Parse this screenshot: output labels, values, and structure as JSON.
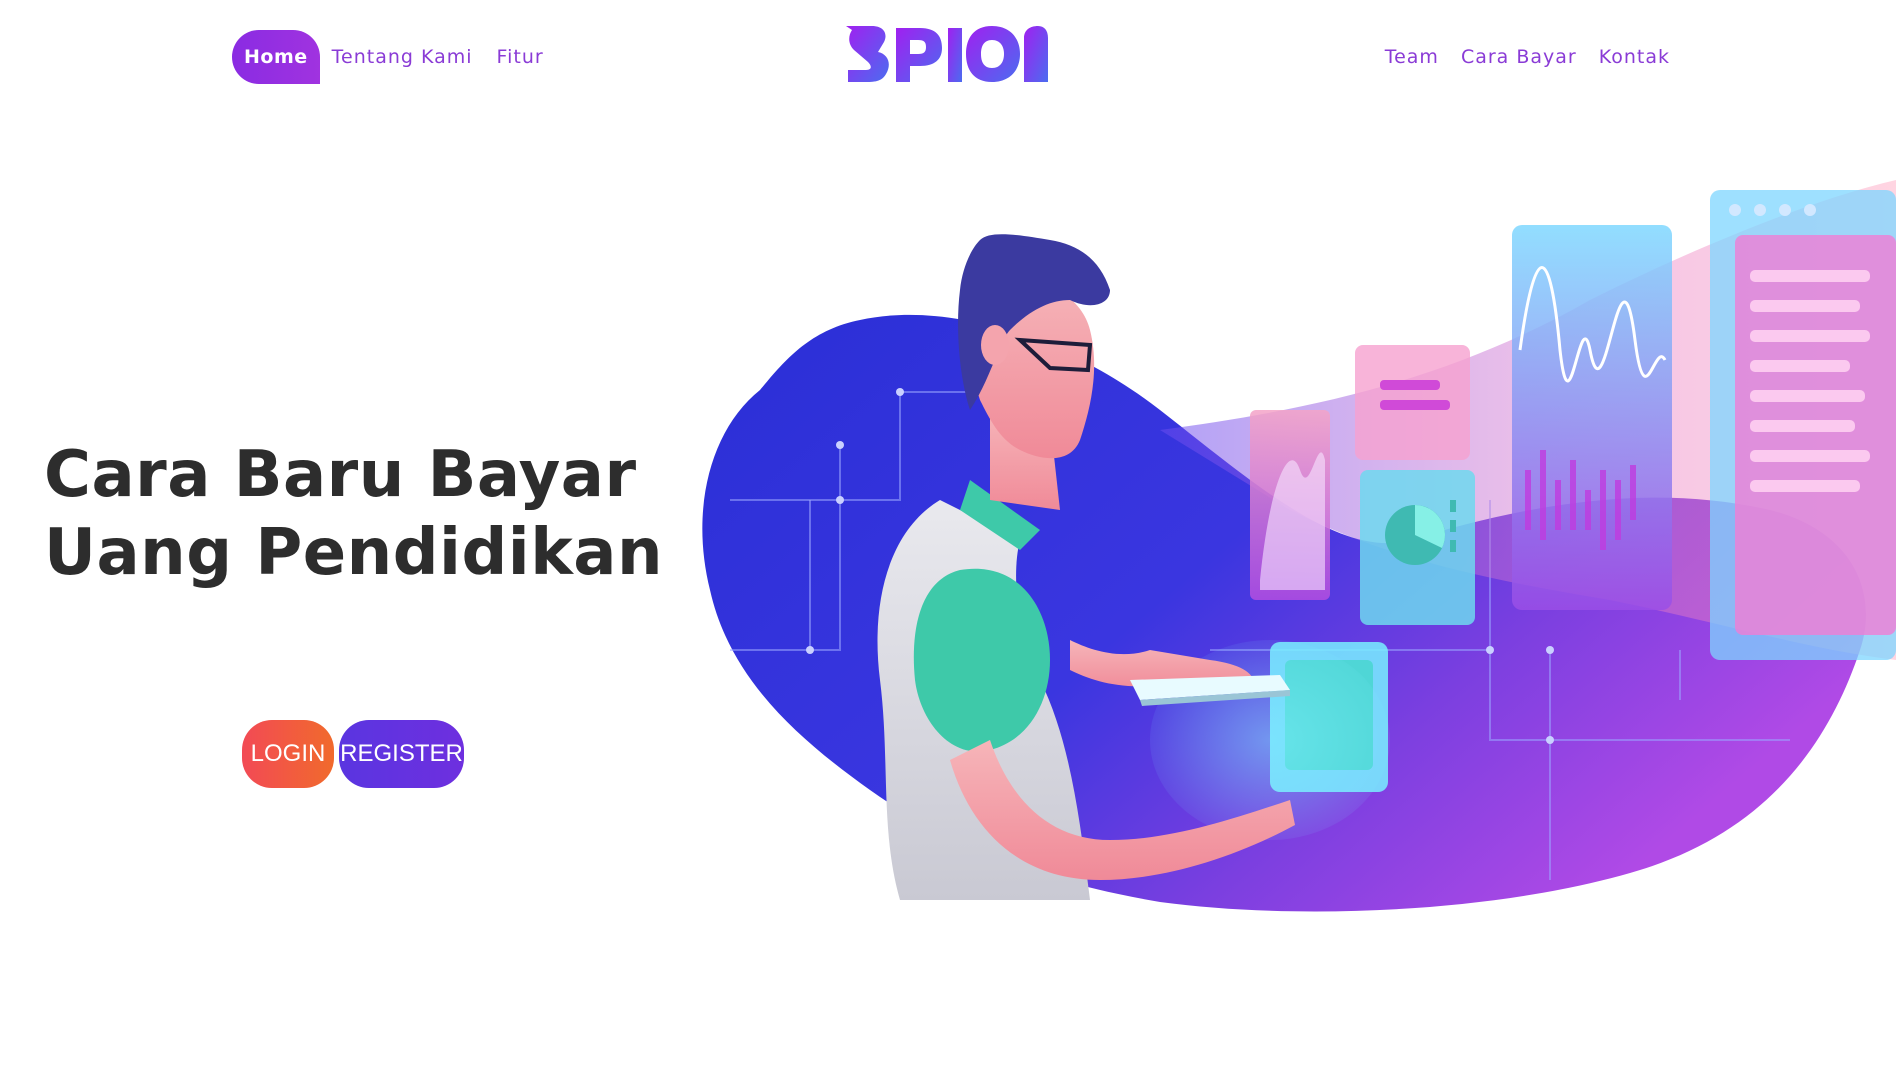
{
  "nav": {
    "left": [
      {
        "label": "Home",
        "active": true
      },
      {
        "label": "Tentang Kami"
      },
      {
        "label": "Fitur"
      }
    ],
    "right": [
      {
        "label": "Team"
      },
      {
        "label": "Cara Bayar"
      },
      {
        "label": "Kontak"
      }
    ]
  },
  "brand": {
    "name": "SPION",
    "gradient": [
      "#8a2be2",
      "#4f6bf0"
    ]
  },
  "hero": {
    "title_line1": "Cara Baru Bayar",
    "title_line2": "Uang Pendidikan"
  },
  "buttons": {
    "login": "LOGIN",
    "register": "REGISTER"
  },
  "illustration": {
    "subject": "man-using-tablet-with-holographic-dashboards"
  },
  "colors": {
    "accent": "#8a3bd6",
    "login": "#f24a55",
    "register": "#5a35e0",
    "heading": "#2d2d2d"
  }
}
